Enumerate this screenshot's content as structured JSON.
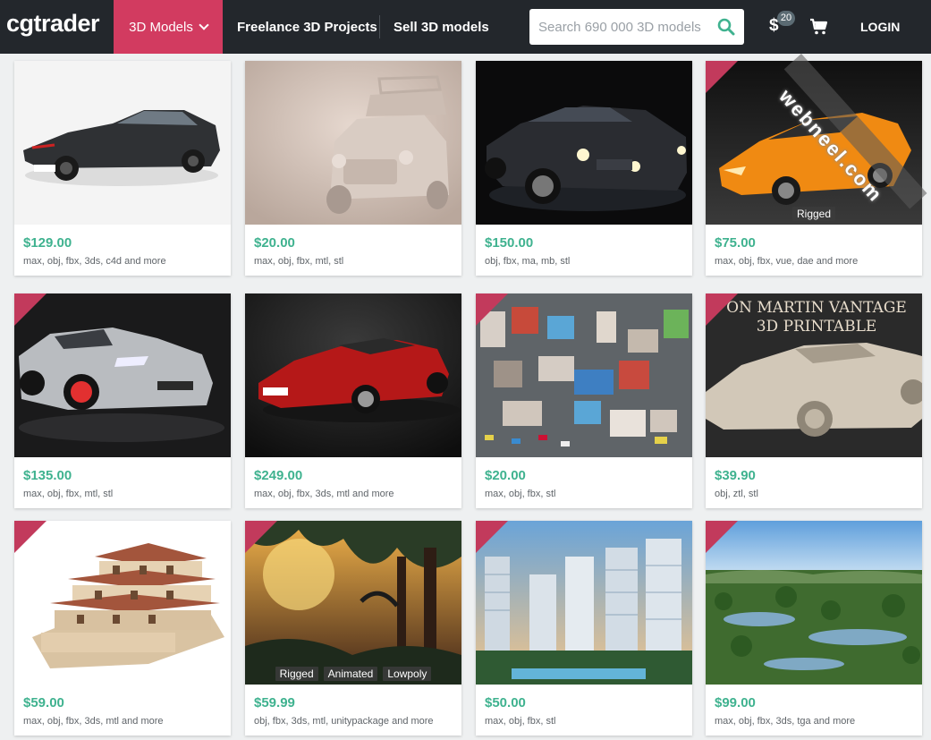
{
  "header": {
    "logo": "cgtrader",
    "nav": {
      "models_label": "3D Models",
      "freelance_label": "Freelance 3D Projects",
      "sell_label": "Sell 3D models"
    },
    "search": {
      "placeholder": "Search 690 000 3D models",
      "value": ""
    },
    "dollar_symbol": "$",
    "dollar_badge": "20",
    "login_label": "LOGIN"
  },
  "watermark": "webneel.com",
  "icons": {
    "search": "search-icon",
    "cart": "cart-icon",
    "chevron": "chevron-down-icon",
    "sale": "sale-ribbon-icon"
  },
  "colors": {
    "header_bg": "#23272c",
    "accent": "#d23b60",
    "price": "#3fb28f",
    "page_bg": "#eef0f1"
  },
  "products": [
    {
      "price": "$129.00",
      "formats": "max, obj, fbx, 3ds, c4d and more",
      "tags": [],
      "sale": false
    },
    {
      "price": "$20.00",
      "formats": "max, obj, fbx, mtl, stl",
      "tags": [],
      "sale": false
    },
    {
      "price": "$150.00",
      "formats": "obj, fbx, ma, mb, stl",
      "tags": [],
      "sale": false
    },
    {
      "price": "$75.00",
      "formats": "max, obj, fbx, vue, dae and more",
      "tags": [
        "Rigged"
      ],
      "sale": true
    },
    {
      "price": "$135.00",
      "formats": "max, obj, fbx, mtl, stl",
      "tags": [],
      "sale": true
    },
    {
      "price": "$249.00",
      "formats": "max, obj, fbx, 3ds, mtl and more",
      "tags": [],
      "sale": false
    },
    {
      "price": "$20.00",
      "formats": "max, obj, fbx, stl",
      "tags": [],
      "sale": true
    },
    {
      "price": "$39.90",
      "formats": "obj, ztl, stl",
      "tags": [],
      "sale": true,
      "image_caption": "ON MARTIN VANTAGE\n3D PRINTABLE"
    },
    {
      "price": "$59.00",
      "formats": "max, obj, fbx, 3ds, mtl and more",
      "tags": [],
      "sale": true
    },
    {
      "price": "$59.99",
      "formats": "obj, fbx, 3ds, mtl, unitypackage and more",
      "tags": [
        "Rigged",
        "Animated",
        "Lowpoly"
      ],
      "sale": true
    },
    {
      "price": "$50.00",
      "formats": "max, obj, fbx, stl",
      "tags": [],
      "sale": true
    },
    {
      "price": "$99.00",
      "formats": "max, obj, fbx, 3ds, tga and more",
      "tags": [],
      "sale": true
    }
  ]
}
